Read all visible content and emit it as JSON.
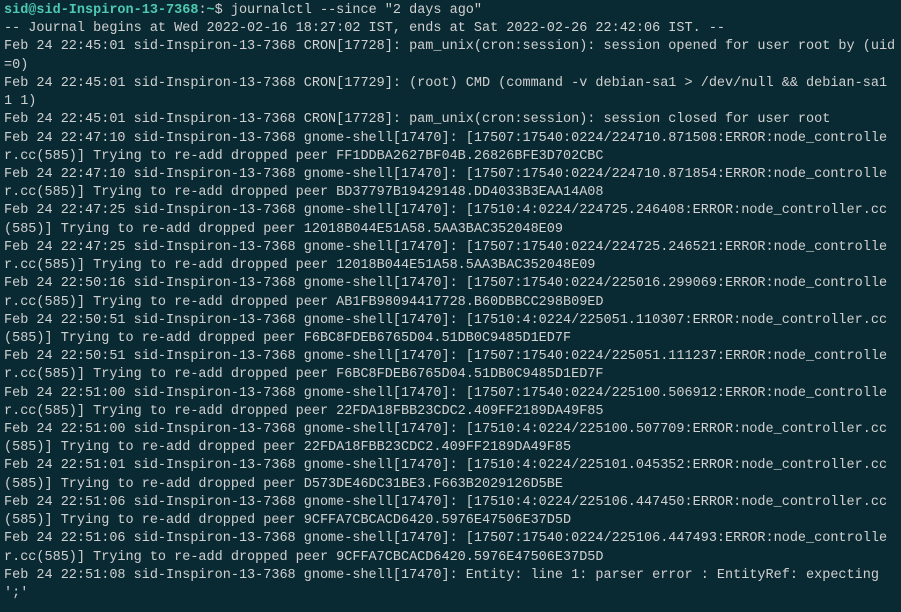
{
  "prompt": {
    "user_host": "sid@sid-Inspiron-13-7368",
    "sep1": ":",
    "path": "~",
    "sep2": "$ ",
    "command": "journalctl --since \"2 days ago\""
  },
  "header": "-- Journal begins at Wed 2022-02-16 18:27:02 IST, ends at Sat 2022-02-26 22:42:06 IST. --",
  "lines": [
    "Feb 24 22:45:01 sid-Inspiron-13-7368 CRON[17728]: pam_unix(cron:session): session opened for user root by (uid=0)",
    "Feb 24 22:45:01 sid-Inspiron-13-7368 CRON[17729]: (root) CMD (command -v debian-sa1 > /dev/null && debian-sa1 1 1)",
    "Feb 24 22:45:01 sid-Inspiron-13-7368 CRON[17728]: pam_unix(cron:session): session closed for user root",
    "Feb 24 22:47:10 sid-Inspiron-13-7368 gnome-shell[17470]: [17507:17540:0224/224710.871508:ERROR:node_controller.cc(585)] Trying to re-add dropped peer FF1DDBA2627BF04B.26826BFE3D702CBC",
    "Feb 24 22:47:10 sid-Inspiron-13-7368 gnome-shell[17470]: [17507:17540:0224/224710.871854:ERROR:node_controller.cc(585)] Trying to re-add dropped peer BD37797B19429148.DD4033B3EAA14A08",
    "Feb 24 22:47:25 sid-Inspiron-13-7368 gnome-shell[17470]: [17510:4:0224/224725.246408:ERROR:node_controller.cc(585)] Trying to re-add dropped peer 12018B044E51A58.5AA3BAC352048E09",
    "Feb 24 22:47:25 sid-Inspiron-13-7368 gnome-shell[17470]: [17507:17540:0224/224725.246521:ERROR:node_controller.cc(585)] Trying to re-add dropped peer 12018B044E51A58.5AA3BAC352048E09",
    "Feb 24 22:50:16 sid-Inspiron-13-7368 gnome-shell[17470]: [17507:17540:0224/225016.299069:ERROR:node_controller.cc(585)] Trying to re-add dropped peer AB1FB98094417728.B60DBBCC298B09ED",
    "Feb 24 22:50:51 sid-Inspiron-13-7368 gnome-shell[17470]: [17510:4:0224/225051.110307:ERROR:node_controller.cc(585)] Trying to re-add dropped peer F6BC8FDEB6765D04.51DB0C9485D1ED7F",
    "Feb 24 22:50:51 sid-Inspiron-13-7368 gnome-shell[17470]: [17507:17540:0224/225051.111237:ERROR:node_controller.cc(585)] Trying to re-add dropped peer F6BC8FDEB6765D04.51DB0C9485D1ED7F",
    "Feb 24 22:51:00 sid-Inspiron-13-7368 gnome-shell[17470]: [17507:17540:0224/225100.506912:ERROR:node_controller.cc(585)] Trying to re-add dropped peer 22FDA18FBB23CDC2.409FF2189DA49F85",
    "Feb 24 22:51:00 sid-Inspiron-13-7368 gnome-shell[17470]: [17510:4:0224/225100.507709:ERROR:node_controller.cc(585)] Trying to re-add dropped peer 22FDA18FBB23CDC2.409FF2189DA49F85",
    "Feb 24 22:51:01 sid-Inspiron-13-7368 gnome-shell[17470]: [17510:4:0224/225101.045352:ERROR:node_controller.cc(585)] Trying to re-add dropped peer D573DE46DC31BE3.F663B2029126D5BE",
    "Feb 24 22:51:06 sid-Inspiron-13-7368 gnome-shell[17470]: [17510:4:0224/225106.447450:ERROR:node_controller.cc(585)] Trying to re-add dropped peer 9CFFA7CBCACD6420.5976E47506E37D5D",
    "Feb 24 22:51:06 sid-Inspiron-13-7368 gnome-shell[17470]: [17507:17540:0224/225106.447493:ERROR:node_controller.cc(585)] Trying to re-add dropped peer 9CFFA7CBCACD6420.5976E47506E37D5D",
    "Feb 24 22:51:08 sid-Inspiron-13-7368 gnome-shell[17470]: Entity: line 1: parser error : EntityRef: expecting ';'"
  ]
}
